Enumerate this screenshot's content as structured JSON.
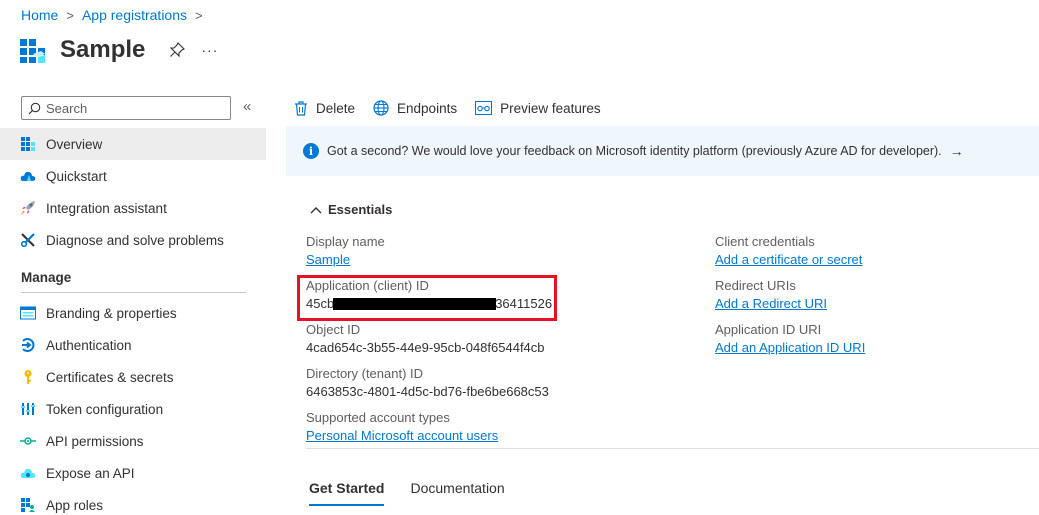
{
  "breadcrumb": {
    "home": "Home",
    "app_registrations": "App registrations",
    "separator": ">"
  },
  "header": {
    "title": "Sample",
    "more": "···"
  },
  "search": {
    "placeholder": "Search"
  },
  "sidebar": {
    "collapse": "«",
    "items_top": [
      {
        "label": "Overview",
        "icon": "grid-icon",
        "active": true
      },
      {
        "label": "Quickstart",
        "icon": "cloud-icon"
      },
      {
        "label": "Integration assistant",
        "icon": "rocket-icon"
      },
      {
        "label": "Diagnose and solve problems",
        "icon": "wrench-icon"
      }
    ],
    "section_manage": "Manage",
    "items_manage": [
      {
        "label": "Branding & properties",
        "icon": "branding-icon"
      },
      {
        "label": "Authentication",
        "icon": "authentication-icon"
      },
      {
        "label": "Certificates & secrets",
        "icon": "key-icon"
      },
      {
        "label": "Token configuration",
        "icon": "token-icon"
      },
      {
        "label": "API permissions",
        "icon": "api-permissions-icon"
      },
      {
        "label": "Expose an API",
        "icon": "cloud-api-icon"
      },
      {
        "label": "App roles",
        "icon": "app-roles-icon"
      }
    ]
  },
  "commands": {
    "delete": "Delete",
    "endpoints": "Endpoints",
    "preview": "Preview features"
  },
  "banner": {
    "text": "Got a second? We would love your feedback on Microsoft identity platform (previously Azure AD for developer).",
    "arrow": "→"
  },
  "essentials": {
    "title": "Essentials",
    "left": {
      "display_name_label": "Display name",
      "display_name_value": "Sample",
      "client_id_label": "Application (client) ID",
      "client_id_prefix": "45cb",
      "client_id_suffix": "36411526",
      "object_id_label": "Object ID",
      "object_id_value": "4cad654c-3b55-44e9-95cb-048f6544f4cb",
      "tenant_id_label": "Directory (tenant) ID",
      "tenant_id_value": "6463853c-4801-4d5c-bd76-fbe6be668c53",
      "account_types_label": "Supported account types",
      "account_types_value": "Personal Microsoft account users"
    },
    "right": {
      "client_credentials_label": "Client credentials",
      "client_credentials_value": "Add a certificate or secret",
      "redirect_uris_label": "Redirect URIs",
      "redirect_uris_value": "Add a Redirect URI",
      "app_id_uri_label": "Application ID URI",
      "app_id_uri_value": "Add an Application ID URI"
    }
  },
  "tabs": [
    {
      "label": "Get Started",
      "active": true
    },
    {
      "label": "Documentation"
    }
  ],
  "colors": {
    "accent": "#0078d4",
    "highlight": "#e81123",
    "banner_bg": "#eff6fc",
    "active_nav_bg": "#ededed"
  }
}
